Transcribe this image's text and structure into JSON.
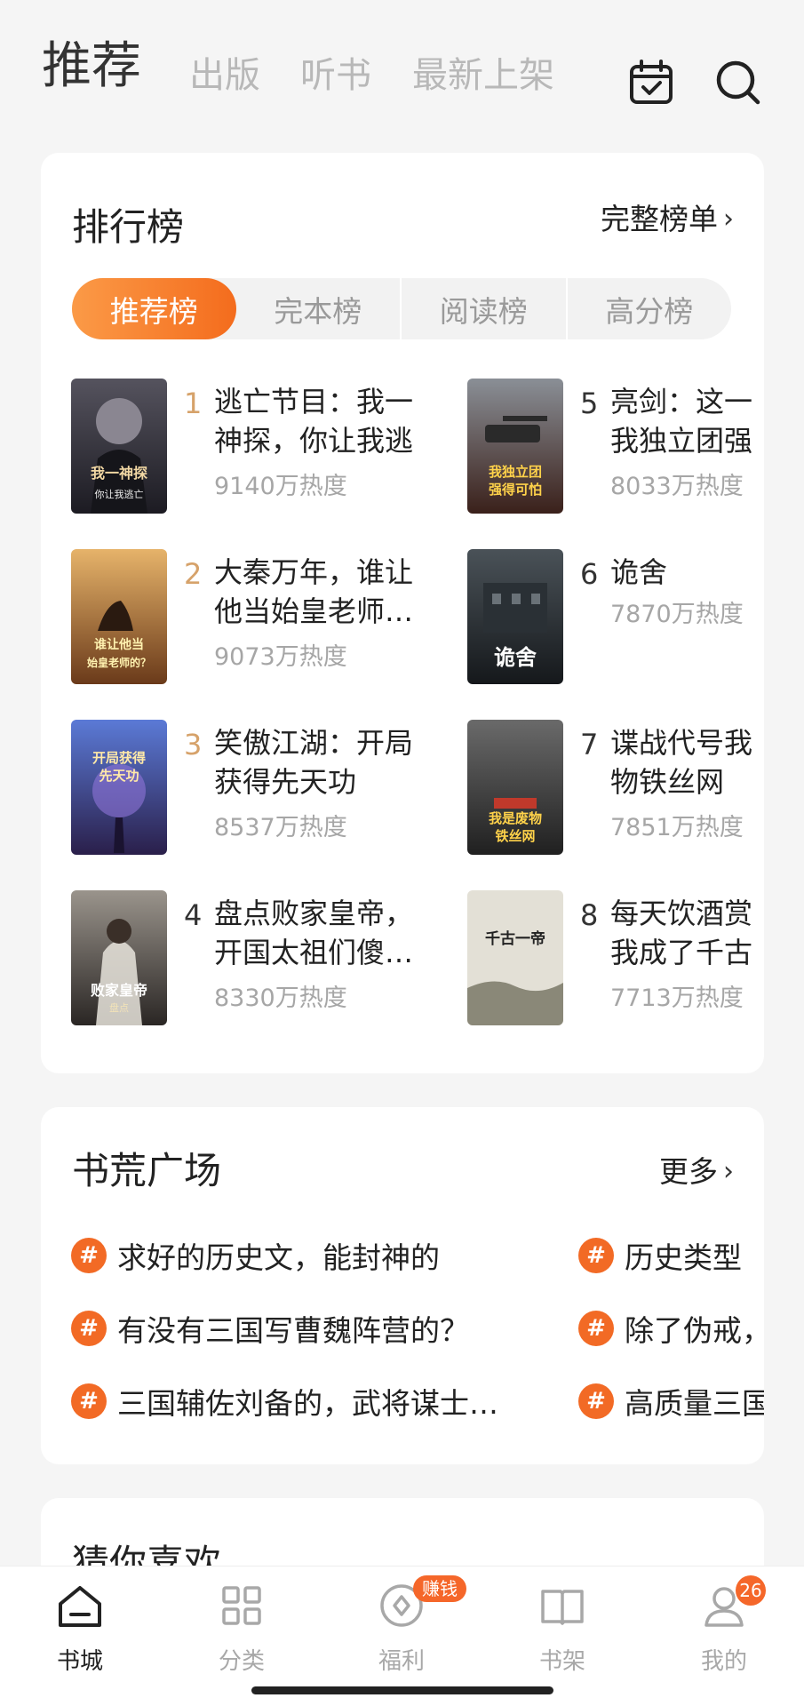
{
  "topnav": {
    "tabs": [
      "推荐",
      "出版",
      "听书",
      "最新上架"
    ],
    "icons": [
      "calendar-check-icon",
      "search-icon"
    ]
  },
  "ranking": {
    "title": "排行榜",
    "more": "完整榜单",
    "tabs": [
      "推荐榜",
      "完本榜",
      "阅读榜",
      "高分榜"
    ],
    "books": [
      {
        "rank": "1",
        "title1": "逃亡节目：我一",
        "title2": "神探，你让我逃",
        "heat": "9140万热度",
        "cover_text": "我一神探，你让我逃亡",
        "cover_color": "#2b2a33"
      },
      {
        "rank": "2",
        "title1": "大秦万年，谁让",
        "title2": "他当始皇老师…",
        "heat": "9073万热度",
        "cover_text": "谁让他当始皇老师的？",
        "cover_color": "#a56a34"
      },
      {
        "rank": "3",
        "title1": "笑傲江湖：开局",
        "title2": "获得先天功",
        "heat": "8537万热度",
        "cover_text": "开局获得先天功",
        "cover_color": "#3a4a8c"
      },
      {
        "rank": "4",
        "title1": "盘点败家皇帝，",
        "title2": "开国太祖们傻…",
        "heat": "8330万热度",
        "cover_text": "盘点败家皇帝",
        "cover_color": "#3d3a38"
      },
      {
        "rank": "5",
        "title1": "亮剑：这一",
        "title2": "我独立团强",
        "heat": "8033万热度",
        "cover_text": "我独立团强得可怕",
        "cover_color": "#5a3a2f"
      },
      {
        "rank": "6",
        "title1": "诡舍",
        "title2": "",
        "heat": "7870万热度",
        "cover_text": "诡舍",
        "cover_color": "#2c3238"
      },
      {
        "rank": "7",
        "title1": "谍战代号我",
        "title2": "物铁丝网",
        "heat": "7851万热度",
        "cover_text": "我是废物铁丝网",
        "cover_color": "#3b3b3b"
      },
      {
        "rank": "8",
        "title1": "每天饮酒赏",
        "title2": "我成了千古",
        "heat": "7713万热度",
        "cover_text": "千古一帝",
        "cover_color": "#d9d6cc"
      }
    ]
  },
  "square": {
    "title": "书荒广场",
    "more": "更多",
    "topics_left": [
      "求好的历史文，能封神的",
      "有没有三国写曹魏阵营的？",
      "三国辅佐刘备的，武将谋士…"
    ],
    "topics_right": [
      "历史类型",
      "除了伪戒，",
      "高质量三国"
    ]
  },
  "guess": {
    "title": "猜你喜欢"
  },
  "bottomnav": {
    "items": [
      "书城",
      "分类",
      "福利",
      "书架",
      "我的"
    ],
    "earn_badge": "赚钱",
    "count_badge": "26"
  }
}
